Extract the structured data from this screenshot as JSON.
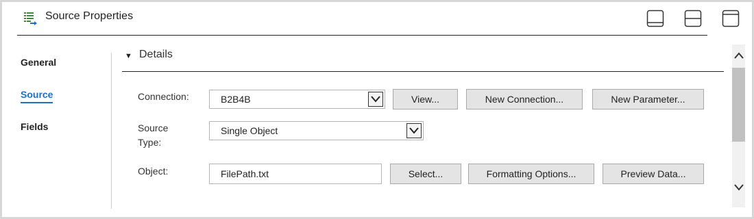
{
  "header": {
    "title": "Source Properties",
    "icon": "table-source-icon",
    "layout_buttons": [
      "layout-bottom-panel-icon",
      "layout-split-icon",
      "layout-top-panel-icon"
    ]
  },
  "nav": {
    "items": [
      {
        "label": "General",
        "active": false
      },
      {
        "label": "Source",
        "active": true
      },
      {
        "label": "Fields",
        "active": false
      }
    ]
  },
  "details": {
    "title": "Details",
    "connection": {
      "label": "Connection:",
      "value": "B2B4B",
      "buttons": [
        "View...",
        "New Connection...",
        "New Parameter..."
      ]
    },
    "source_type": {
      "label_line1": "Source",
      "label_line2": "Type:",
      "value": "Single Object"
    },
    "object": {
      "label": "Object:",
      "value": "FilePath.txt",
      "buttons": [
        "Select...",
        "Formatting Options...",
        "Preview Data..."
      ]
    }
  },
  "colors": {
    "accent": "#1e6fc8",
    "button_bg": "#e4e4e4",
    "frame_border": "#d6d6d6"
  }
}
